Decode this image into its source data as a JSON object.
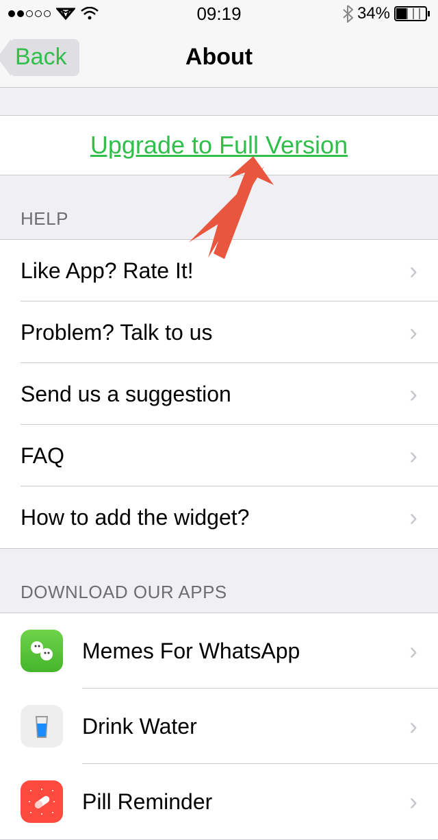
{
  "status": {
    "time": "09:19",
    "battery_pct": "34%"
  },
  "nav": {
    "back_label": "Back",
    "title": "About"
  },
  "upgrade": {
    "link_text": "Upgrade to Full Version"
  },
  "sections": {
    "help_header": "HELP",
    "download_header": "DOWNLOAD OUR APPS"
  },
  "help_items": [
    {
      "label": "Like App? Rate It!"
    },
    {
      "label": "Problem? Talk to us"
    },
    {
      "label": "Send us a suggestion"
    },
    {
      "label": "FAQ"
    },
    {
      "label": "How to add the widget?"
    }
  ],
  "apps": [
    {
      "label": "Memes For WhatsApp",
      "icon": "memes"
    },
    {
      "label": "Drink Water",
      "icon": "water"
    },
    {
      "label": "Pill Reminder",
      "icon": "pill"
    }
  ]
}
